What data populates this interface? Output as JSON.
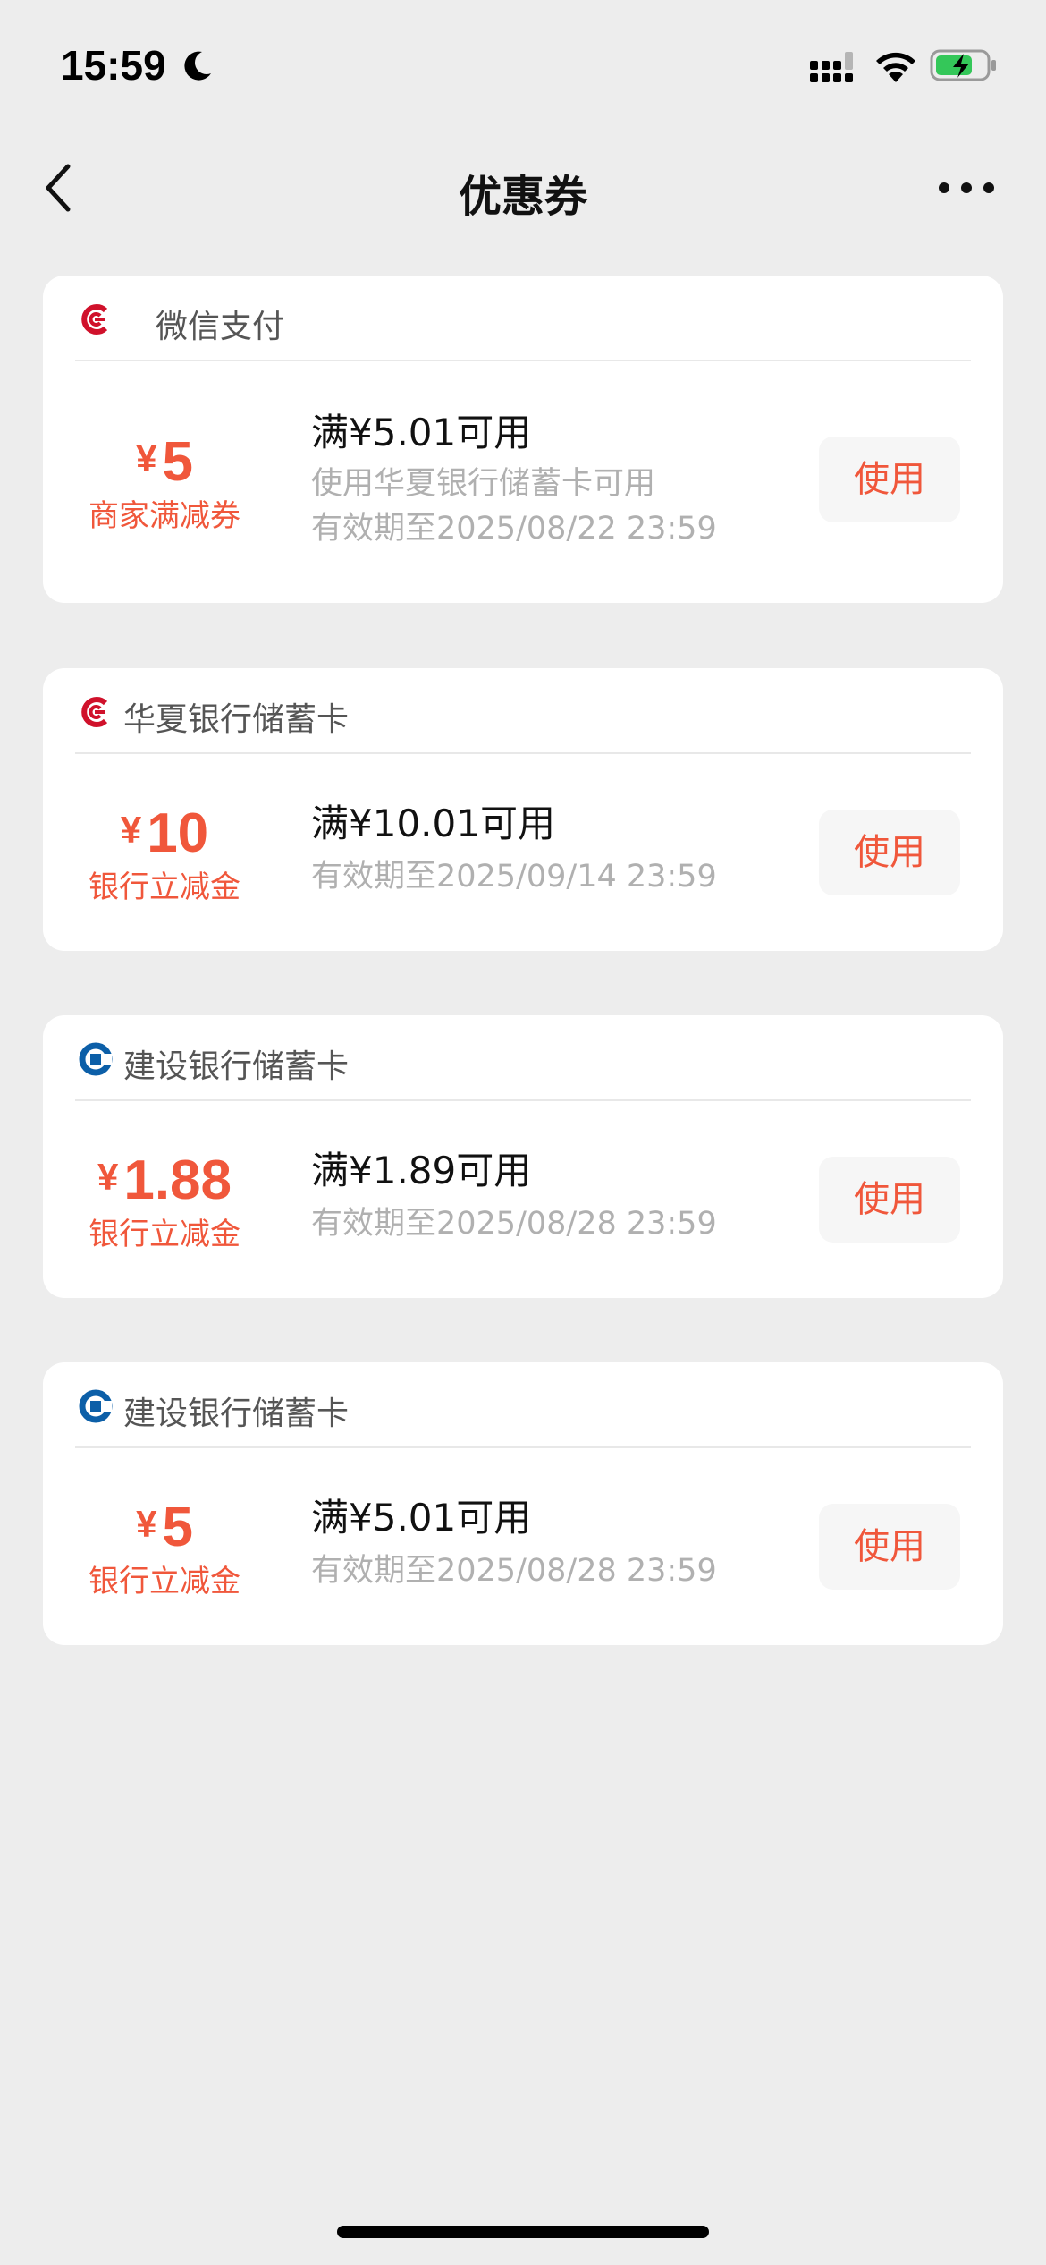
{
  "status_bar": {
    "time": "15:59",
    "moon_icon": "moon-icon",
    "signal_icon": "cellular-signal-icon",
    "wifi_icon": "wifi-icon",
    "battery_icon": "battery-charging-icon",
    "battery_color": "#34c759"
  },
  "nav": {
    "title": "优惠券",
    "back_icon": "chevron-left-icon",
    "more_icon": "more-dots-icon"
  },
  "accent_color": "#f0573b",
  "coupons": [
    {
      "issuer": "微信支付",
      "logo_icon": "hua-xia-bank-logo",
      "logo_color": "#d0112b",
      "yen": "¥",
      "amount": "5",
      "type": "商家满减券",
      "condition": "满¥5.01可用",
      "restriction": "使用华夏银行储蓄卡可用",
      "validity": "有效期至2025/08/22 23:59",
      "button": "使用"
    },
    {
      "issuer": "华夏银行储蓄卡",
      "logo_icon": "hua-xia-bank-logo",
      "logo_color": "#d0112b",
      "yen": "¥",
      "amount": "10",
      "type": "银行立减金",
      "condition": "满¥10.01可用",
      "validity": "有效期至2025/09/14 23:59",
      "button": "使用"
    },
    {
      "issuer": "建设银行储蓄卡",
      "logo_icon": "ccb-bank-logo",
      "logo_color": "#0c5fa8",
      "yen": "¥",
      "amount": "1.88",
      "type": "银行立减金",
      "condition": "满¥1.89可用",
      "validity": "有效期至2025/08/28 23:59",
      "button": "使用"
    },
    {
      "issuer": "建设银行储蓄卡",
      "logo_icon": "ccb-bank-logo",
      "logo_color": "#0c5fa8",
      "yen": "¥",
      "amount": "5",
      "type": "银行立减金",
      "condition": "满¥5.01可用",
      "validity": "有效期至2025/08/28 23:59",
      "button": "使用"
    }
  ]
}
